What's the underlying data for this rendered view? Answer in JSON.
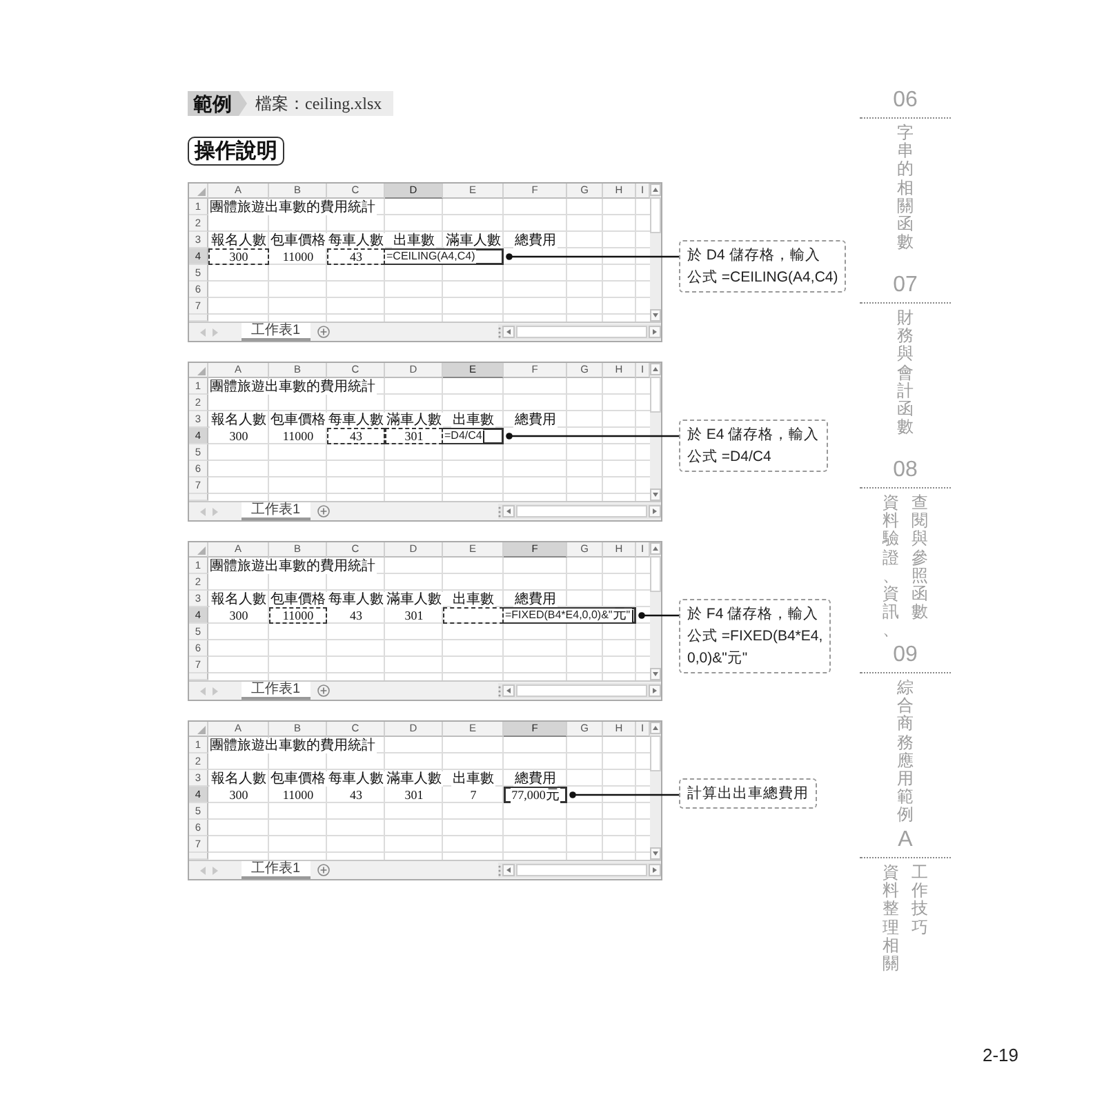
{
  "header": {
    "tag": "範例",
    "file": "檔案：ceiling.xlsx"
  },
  "section_title": "操作說明",
  "examples": [
    {
      "sheet": {
        "columns": [
          {
            "label": "A",
            "selected": false
          },
          {
            "label": "B",
            "selected": false
          },
          {
            "label": "C",
            "selected": false
          },
          {
            "label": "D",
            "selected": true
          },
          {
            "label": "E",
            "selected": false
          },
          {
            "label": "F",
            "selected": false
          },
          {
            "label": "G",
            "selected": false
          },
          {
            "label": "H",
            "selected": false
          },
          {
            "label": "I",
            "selected": false
          }
        ],
        "rows": [
          {
            "label": "1",
            "selected": false,
            "cells": [
              {
                "kind": "text",
                "text": "團體旅遊出車數的費用統計",
                "referenced": false,
                "active": false
              }
            ]
          },
          {
            "label": "2",
            "selected": false
          },
          {
            "label": "3",
            "selected": false,
            "cells": [
              {
                "kind": "value",
                "text": "報名人數",
                "referenced": false,
                "active": false
              },
              {
                "kind": "value",
                "text": "包車價格",
                "referenced": false,
                "active": false
              },
              {
                "kind": "value",
                "text": "每車人數",
                "referenced": false,
                "active": false
              },
              {
                "kind": "value",
                "text": "出車數",
                "referenced": false,
                "active": false
              },
              {
                "kind": "value",
                "text": "滿車人數",
                "referenced": false,
                "active": false
              },
              {
                "kind": "value",
                "text": "總費用",
                "referenced": false,
                "active": false
              }
            ]
          },
          {
            "label": "4",
            "selected": true,
            "cells": [
              {
                "kind": "value",
                "text": "300",
                "referenced": true,
                "active": false
              },
              {
                "kind": "value",
                "text": "11000",
                "referenced": false,
                "active": false
              },
              {
                "kind": "value",
                "text": "43",
                "referenced": true,
                "active": false
              },
              {
                "kind": "formula",
                "text": "=CEILING(A4,C4)",
                "referenced": false,
                "active": true,
                "cursor": false
              }
            ]
          },
          {
            "label": "5",
            "selected": false
          },
          {
            "label": "6",
            "selected": false
          },
          {
            "label": "7",
            "selected": false
          }
        ],
        "sheet_tab": "工作表1"
      },
      "callout": {
        "lines": [
          "於 D4 儲存格，輸入",
          "公式 =CEILING(A4,C4)"
        ]
      }
    },
    {
      "sheet": {
        "columns": [
          {
            "label": "A",
            "selected": false
          },
          {
            "label": "B",
            "selected": false
          },
          {
            "label": "C",
            "selected": false
          },
          {
            "label": "D",
            "selected": false
          },
          {
            "label": "E",
            "selected": true
          },
          {
            "label": "F",
            "selected": false
          },
          {
            "label": "G",
            "selected": false
          },
          {
            "label": "H",
            "selected": false
          },
          {
            "label": "I",
            "selected": false
          }
        ],
        "rows": [
          {
            "label": "1",
            "selected": false,
            "cells": [
              {
                "kind": "text",
                "text": "團體旅遊出車數的費用統計",
                "referenced": false,
                "active": false
              }
            ]
          },
          {
            "label": "2",
            "selected": false
          },
          {
            "label": "3",
            "selected": false,
            "cells": [
              {
                "kind": "value",
                "text": "報名人數",
                "referenced": false,
                "active": false
              },
              {
                "kind": "value",
                "text": "包車價格",
                "referenced": false,
                "active": false
              },
              {
                "kind": "value",
                "text": "每車人數",
                "referenced": false,
                "active": false
              },
              {
                "kind": "value",
                "text": "滿車人數",
                "referenced": false,
                "active": false
              },
              {
                "kind": "value",
                "text": "出車數",
                "referenced": false,
                "active": false
              },
              {
                "kind": "value",
                "text": "總費用",
                "referenced": false,
                "active": false
              }
            ]
          },
          {
            "label": "4",
            "selected": true,
            "cells": [
              {
                "kind": "value",
                "text": "300",
                "referenced": false,
                "active": false
              },
              {
                "kind": "value",
                "text": "11000",
                "referenced": false,
                "active": false
              },
              {
                "kind": "value",
                "text": "43",
                "referenced": true,
                "active": false
              },
              {
                "kind": "value",
                "text": "301",
                "referenced": true,
                "active": false
              },
              {
                "kind": "formula",
                "text": "=D4/C4",
                "referenced": false,
                "active": true,
                "cursor": true
              }
            ]
          },
          {
            "label": "5",
            "selected": false
          },
          {
            "label": "6",
            "selected": false
          },
          {
            "label": "7",
            "selected": false
          }
        ],
        "sheet_tab": "工作表1"
      },
      "callout": {
        "lines": [
          "於 E4 儲存格，輸入",
          "公式 =D4/C4"
        ]
      }
    },
    {
      "sheet": {
        "columns": [
          {
            "label": "A",
            "selected": false
          },
          {
            "label": "B",
            "selected": false
          },
          {
            "label": "C",
            "selected": false
          },
          {
            "label": "D",
            "selected": false
          },
          {
            "label": "E",
            "selected": false
          },
          {
            "label": "F",
            "selected": true
          },
          {
            "label": "G",
            "selected": false
          },
          {
            "label": "H",
            "selected": false
          },
          {
            "label": "I",
            "selected": false
          }
        ],
        "rows": [
          {
            "label": "1",
            "selected": false,
            "cells": [
              {
                "kind": "text",
                "text": "團體旅遊出車數的費用統計",
                "referenced": false,
                "active": false
              }
            ]
          },
          {
            "label": "2",
            "selected": false
          },
          {
            "label": "3",
            "selected": false,
            "cells": [
              {
                "kind": "value",
                "text": "報名人數",
                "referenced": false,
                "active": false
              },
              {
                "kind": "value",
                "text": "包車價格",
                "referenced": false,
                "active": false
              },
              {
                "kind": "value",
                "text": "每車人數",
                "referenced": false,
                "active": false
              },
              {
                "kind": "value",
                "text": "滿車人數",
                "referenced": false,
                "active": false
              },
              {
                "kind": "value",
                "text": "出車數",
                "referenced": false,
                "active": false
              },
              {
                "kind": "value",
                "text": "總費用",
                "referenced": false,
                "active": false
              }
            ]
          },
          {
            "label": "4",
            "selected": true,
            "cells": [
              {
                "kind": "value",
                "text": "300",
                "referenced": false,
                "active": false
              },
              {
                "kind": "value",
                "text": "11000",
                "referenced": true,
                "active": false
              },
              {
                "kind": "value",
                "text": "43",
                "referenced": false,
                "active": false
              },
              {
                "kind": "value",
                "text": "301",
                "referenced": false,
                "active": false
              },
              {
                "kind": "empty",
                "referenced": true,
                "active": false
              },
              {
                "kind": "formula",
                "text": "=FIXED(B4*E4,0,0)&\"元\"",
                "referenced": false,
                "active": true,
                "cursor": true
              }
            ]
          },
          {
            "label": "5",
            "selected": false
          },
          {
            "label": "6",
            "selected": false
          },
          {
            "label": "7",
            "selected": false
          }
        ],
        "sheet_tab": "工作表1"
      },
      "callout": {
        "lines": [
          "於 F4 儲存格，輸入",
          "公式 =FIXED(B4*E4,",
          "0,0)&\"元\""
        ]
      }
    },
    {
      "sheet": {
        "columns": [
          {
            "label": "A",
            "selected": false
          },
          {
            "label": "B",
            "selected": false
          },
          {
            "label": "C",
            "selected": false
          },
          {
            "label": "D",
            "selected": false
          },
          {
            "label": "E",
            "selected": false
          },
          {
            "label": "F",
            "selected": true
          },
          {
            "label": "G",
            "selected": false
          },
          {
            "label": "H",
            "selected": false
          },
          {
            "label": "I",
            "selected": false
          }
        ],
        "rows": [
          {
            "label": "1",
            "selected": false,
            "cells": [
              {
                "kind": "text",
                "text": "團體旅遊出車數的費用統計",
                "referenced": false,
                "active": false
              }
            ]
          },
          {
            "label": "2",
            "selected": false
          },
          {
            "label": "3",
            "selected": false,
            "cells": [
              {
                "kind": "value",
                "text": "報名人數",
                "referenced": false,
                "active": false
              },
              {
                "kind": "value",
                "text": "包車價格",
                "referenced": false,
                "active": false
              },
              {
                "kind": "value",
                "text": "每車人數",
                "referenced": false,
                "active": false
              },
              {
                "kind": "value",
                "text": "滿車人數",
                "referenced": false,
                "active": false
              },
              {
                "kind": "value",
                "text": "出車數",
                "referenced": false,
                "active": false
              },
              {
                "kind": "value",
                "text": "總費用",
                "referenced": false,
                "active": false
              }
            ]
          },
          {
            "label": "4",
            "selected": true,
            "cells": [
              {
                "kind": "value",
                "text": "300",
                "referenced": false,
                "active": false
              },
              {
                "kind": "value",
                "text": "11000",
                "referenced": false,
                "active": false
              },
              {
                "kind": "value",
                "text": "43",
                "referenced": false,
                "active": false
              },
              {
                "kind": "value",
                "text": "301",
                "referenced": false,
                "active": false
              },
              {
                "kind": "value",
                "text": "7",
                "referenced": false,
                "active": false
              },
              {
                "kind": "value",
                "text": "77,000元",
                "referenced": false,
                "active": true
              }
            ]
          },
          {
            "label": "5",
            "selected": false
          },
          {
            "label": "6",
            "selected": false
          },
          {
            "label": "7",
            "selected": false
          }
        ],
        "sheet_tab": "工作表1"
      },
      "callout": {
        "lines": [
          "計算出出車總費用"
        ]
      }
    }
  ],
  "chapter_tabs": [
    {
      "number": "06",
      "columns": [
        "字串的相關函數"
      ]
    },
    {
      "number": "07",
      "columns": [
        "財務與會計函數"
      ]
    },
    {
      "number": "08",
      "columns": [
        "資料驗證、資訊、",
        "查閱與參照函數"
      ]
    },
    {
      "number": "09",
      "columns": [
        "綜合商務應用範例"
      ]
    },
    {
      "number": "A",
      "columns": [
        "資料整理相關",
        "工作技巧"
      ]
    }
  ],
  "page_number": "2-19"
}
